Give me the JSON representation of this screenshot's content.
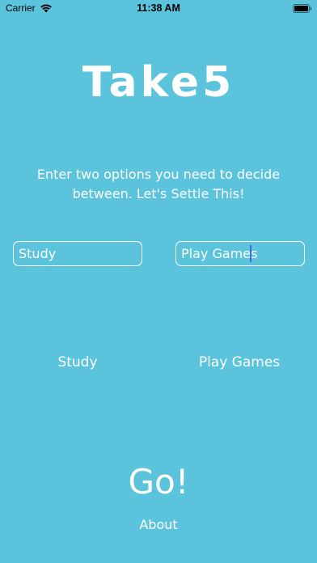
{
  "status_bar": {
    "carrier": "Carrier",
    "time": "11:38 AM",
    "wifi_icon": "wifi-icon",
    "battery_icon": "battery-icon"
  },
  "app": {
    "title": "Take5",
    "instructions": "Enter two options you need to decide between. Let's Settle This!"
  },
  "inputs": {
    "option_one_value": "Study",
    "option_two_value": "Play Games"
  },
  "labels": {
    "option_one": "Study",
    "option_two": "Play Games"
  },
  "actions": {
    "go_label": "Go!",
    "about_label": "About"
  },
  "colors": {
    "background": "#5bc4dc",
    "text": "#ffffff",
    "caret": "#3b6fe0"
  }
}
